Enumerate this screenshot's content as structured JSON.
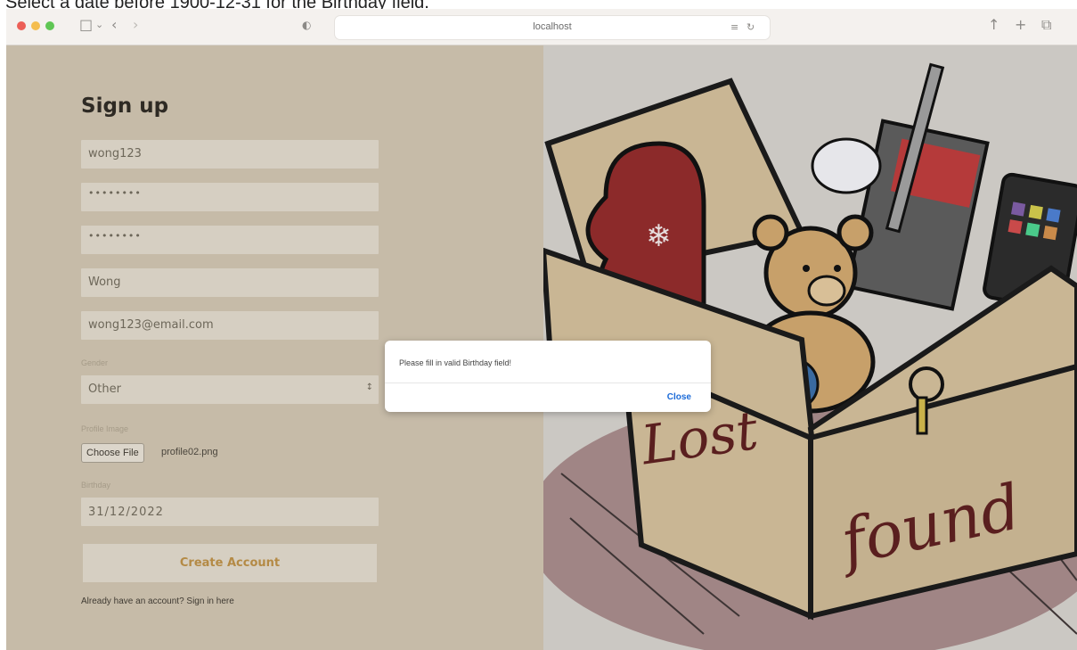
{
  "instruction": "Select a date before 1900-12-31 for the Birthday field.",
  "browser": {
    "url": "localhost"
  },
  "form": {
    "title": "Sign up",
    "username_value": "wong123",
    "password_value": "••••••••",
    "confirm_password_value": "••••••••",
    "name_value": "Wong",
    "email_value": "wong123@email.com",
    "gender_label": "Gender",
    "gender_value": "Other",
    "profile_image_label": "Profile Image",
    "choose_file_label": "Choose File",
    "file_name": "profile02.png",
    "birthday_label": "Birthday",
    "birthday_value": "31/12/2022",
    "submit_label": "Create Account",
    "signin_text": "Already have an account? Sign in here"
  },
  "modal": {
    "message": "Please fill in valid Birthday field!",
    "close_label": "Close"
  },
  "illustration": {
    "lettering": "lost found"
  }
}
